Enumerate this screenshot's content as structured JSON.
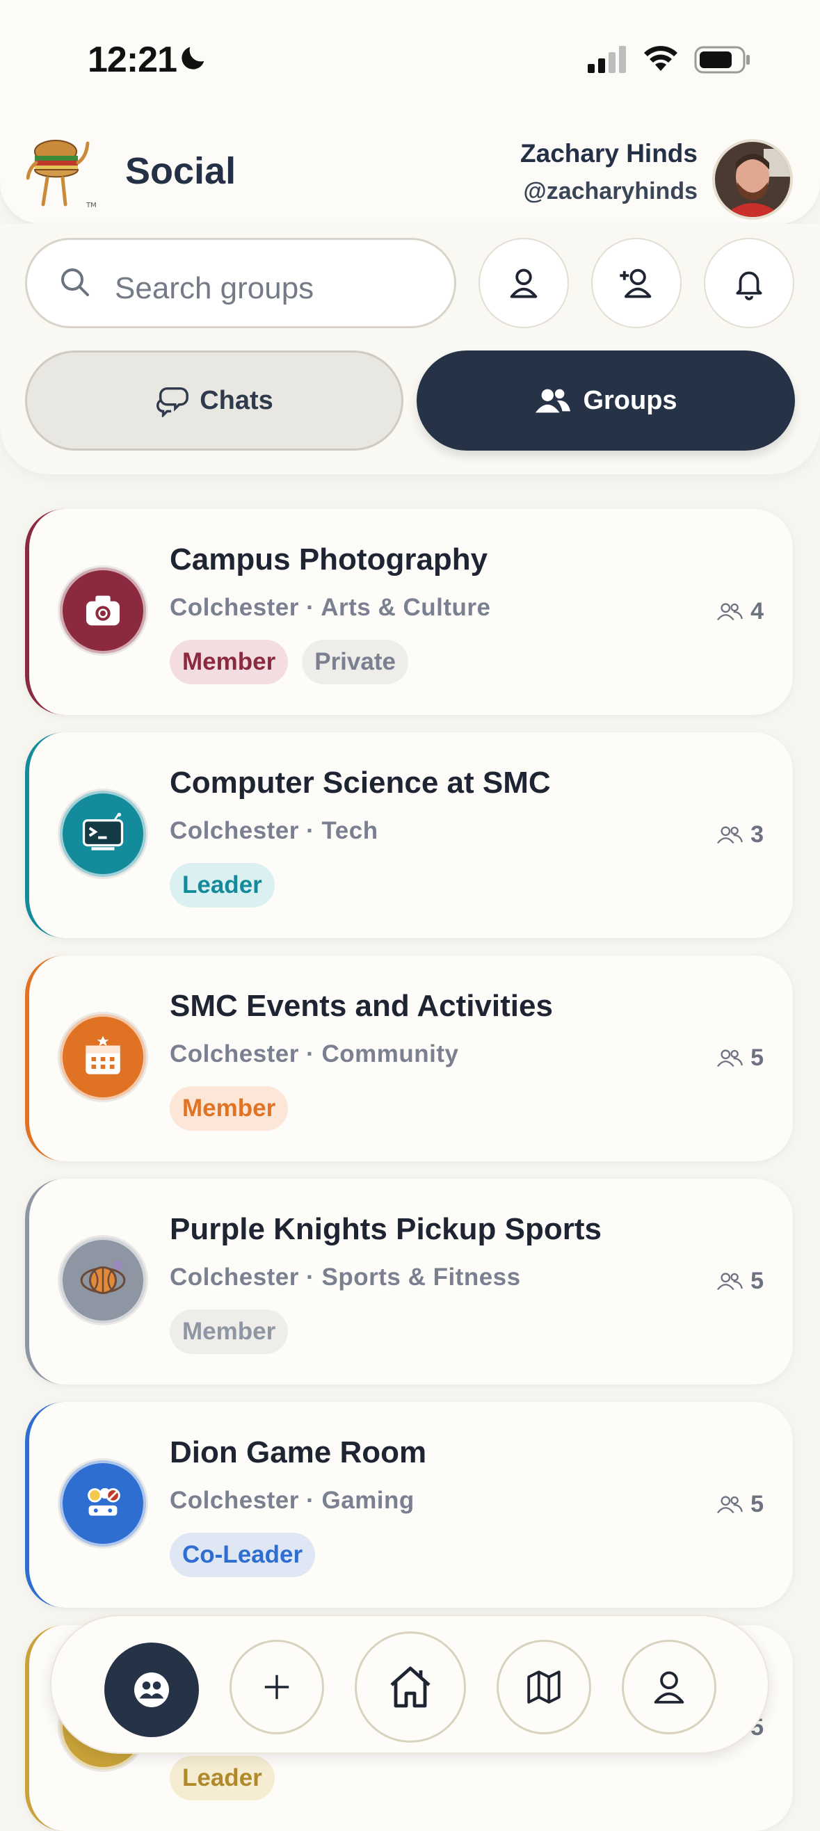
{
  "status_bar": {
    "time": "12:21"
  },
  "header": {
    "title": "Social",
    "user_name": "Zachary Hinds",
    "user_handle": "@zacharyhinds"
  },
  "search": {
    "placeholder": "Search groups"
  },
  "segments": {
    "chats_label": "Chats",
    "groups_label": "Groups",
    "active": "Groups"
  },
  "groups": [
    {
      "name": "Campus Photography",
      "subtitle": "Colchester · Arts & Culture",
      "badges": [
        "Member",
        "Private"
      ],
      "members": "4",
      "accent": "#8b2a3e",
      "icon": "camera-icon"
    },
    {
      "name": "Computer Science at SMC",
      "subtitle": "Colchester · Tech",
      "badges": [
        "Leader"
      ],
      "members": "3",
      "accent": "#138b9b",
      "icon": "terminal-icon"
    },
    {
      "name": "SMC Events and Activities",
      "subtitle": "Colchester · Community",
      "badges": [
        "Member"
      ],
      "members": "5",
      "accent": "#e07224",
      "icon": "calendar-icon"
    },
    {
      "name": "Purple Knights Pickup Sports",
      "subtitle": "Colchester · Sports & Fitness",
      "badges": [
        "Member"
      ],
      "members": "5",
      "accent": "#8f96a3",
      "icon": "basketball-icon"
    },
    {
      "name": "Dion Game Room",
      "subtitle": "Colchester · Gaming",
      "badges": [
        "Co-Leader"
      ],
      "members": "5",
      "accent": "#2e6ed1",
      "icon": "game-pieces-icon"
    },
    {
      "name": "",
      "subtitle": "",
      "badges": [
        "Leader"
      ],
      "members": "5",
      "accent": "#c9a339",
      "icon": "coin-icon"
    }
  ],
  "colors": {
    "navy": "#263246",
    "background": "#f7f5ef"
  }
}
